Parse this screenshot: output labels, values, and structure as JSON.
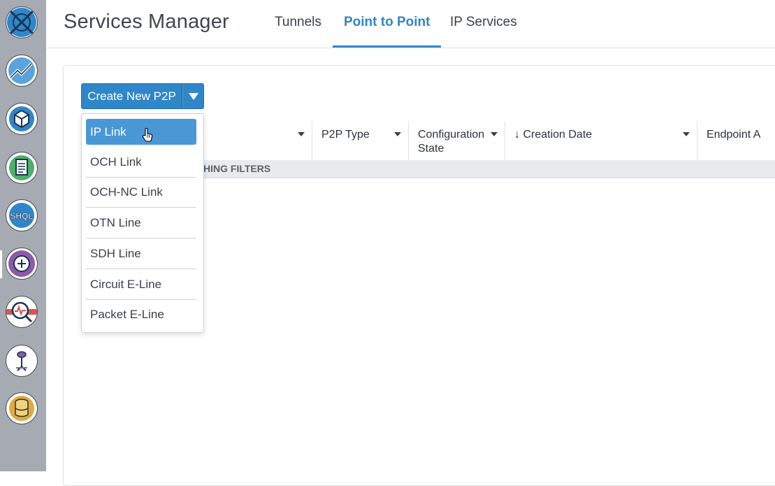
{
  "header": {
    "app_title": "Services Manager",
    "tabs": [
      {
        "label": "Tunnels",
        "active": false
      },
      {
        "label": "Point to Point",
        "active": true
      },
      {
        "label": "IP Services",
        "active": false
      }
    ]
  },
  "rail": {
    "items": [
      {
        "icon": "globe-network-icon"
      },
      {
        "icon": "analytics-chart-icon"
      },
      {
        "icon": "cube-icon"
      },
      {
        "icon": "document-icon"
      },
      {
        "icon": "shql-icon"
      },
      {
        "icon": "add-service-icon"
      },
      {
        "icon": "health-search-icon"
      },
      {
        "icon": "antenna-icon"
      },
      {
        "icon": "database-icon"
      }
    ]
  },
  "toolbar": {
    "create_label": "Create New P2P"
  },
  "dropdown": {
    "items": [
      {
        "label": "IP Link",
        "selected": true
      },
      {
        "label": "OCH Link"
      },
      {
        "label": "OCH-NC Link"
      },
      {
        "label": "OTN Line"
      },
      {
        "label": "SDH Line"
      },
      {
        "label": "Circuit E-Line"
      },
      {
        "label": "Packet E-Line"
      }
    ]
  },
  "table": {
    "columns": [
      {
        "label": ""
      },
      {
        "label": "P2P Type"
      },
      {
        "label": "Configuration State"
      },
      {
        "label": "↓ Creation Date"
      },
      {
        "label": "Endpoint A"
      }
    ],
    "empty_text": "HING FILTERS"
  },
  "colors": {
    "accent": "#2f86c9",
    "rail_bg": "#a5aab3",
    "selected_item": "#4a97d5"
  }
}
